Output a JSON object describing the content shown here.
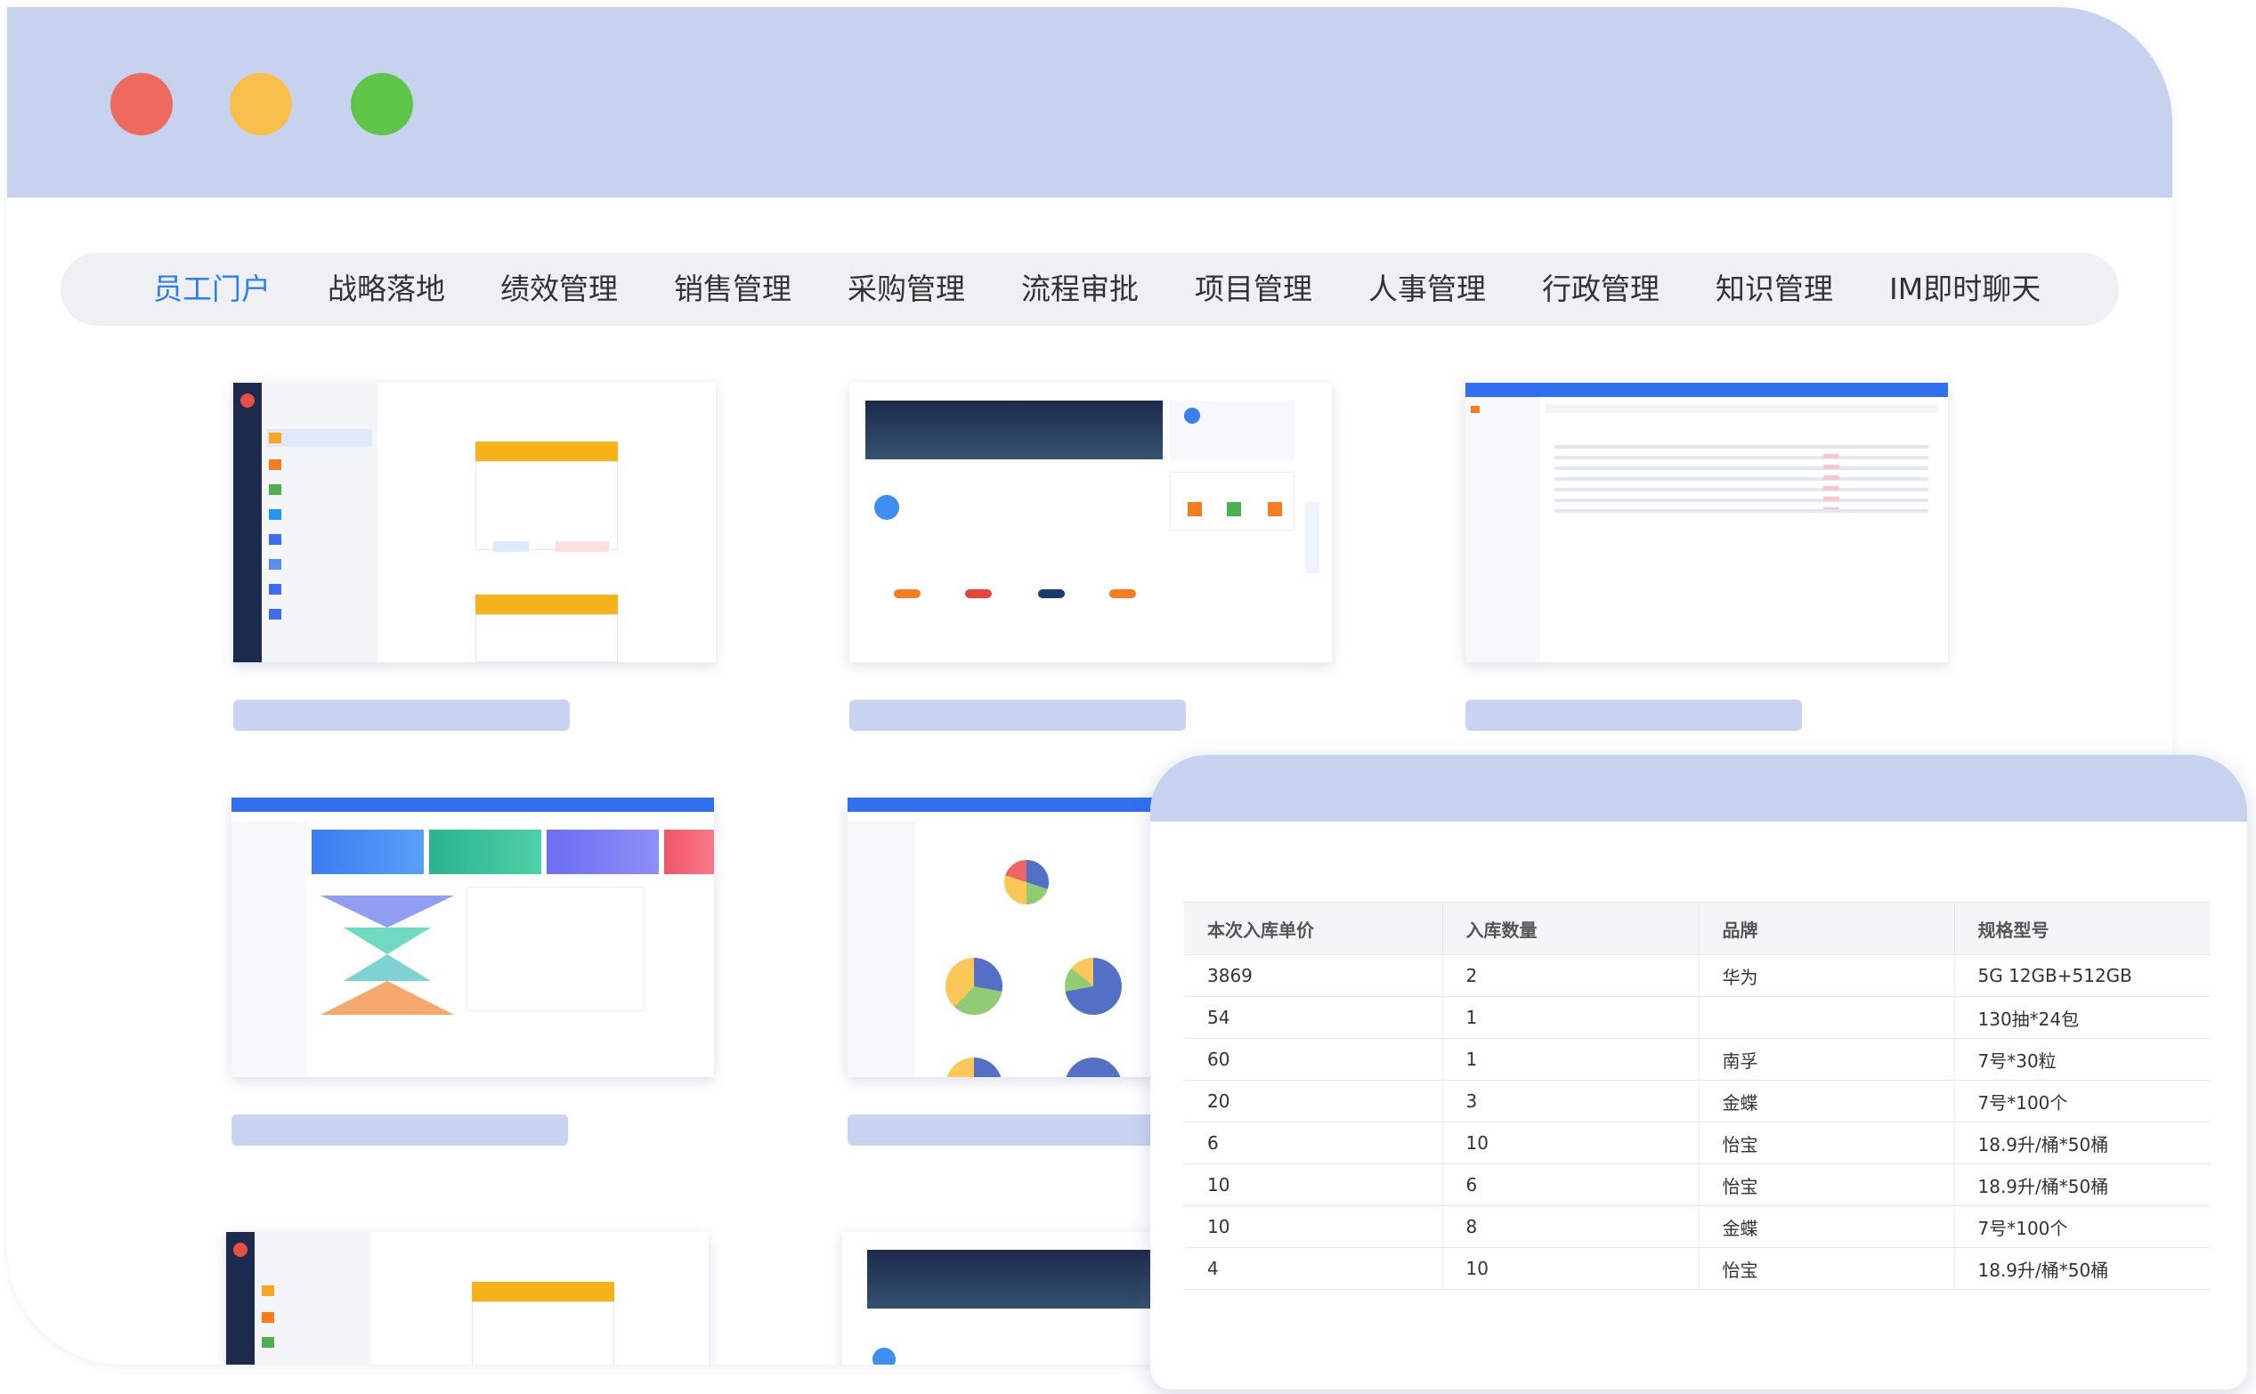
{
  "nav": {
    "items": [
      {
        "label": "员工门户",
        "active": true
      },
      {
        "label": "战略落地"
      },
      {
        "label": "绩效管理"
      },
      {
        "label": "销售管理"
      },
      {
        "label": "采购管理"
      },
      {
        "label": "流程审批"
      },
      {
        "label": "项目管理"
      },
      {
        "label": "人事管理"
      },
      {
        "label": "行政管理"
      },
      {
        "label": "知识管理"
      },
      {
        "label": "IM即时聊天"
      }
    ]
  },
  "colors": {
    "titlebar": "#c7d3ee",
    "accent": "#2b7ff0",
    "close": "#ee6a5f",
    "minimize": "#f8bf4b",
    "maximize": "#5dc548"
  },
  "inventory_table": {
    "headers": [
      "本次入库单价",
      "入库数量",
      "品牌",
      "规格型号"
    ],
    "rows": [
      [
        "3869",
        "2",
        "华为",
        "5G 12GB+512GB"
      ],
      [
        "54",
        "1",
        "",
        "130抽*24包"
      ],
      [
        "60",
        "1",
        "南孚",
        "7号*30粒"
      ],
      [
        "20",
        "3",
        "金蝶",
        "7号*100个"
      ],
      [
        "6",
        "10",
        "怡宝",
        "18.9升/桶*50桶"
      ],
      [
        "10",
        "6",
        "怡宝",
        "18.9升/桶*50桶"
      ],
      [
        "10",
        "8",
        "金蝶",
        "7号*100个"
      ],
      [
        "4",
        "10",
        "怡宝",
        "18.9升/桶*50桶"
      ]
    ]
  }
}
